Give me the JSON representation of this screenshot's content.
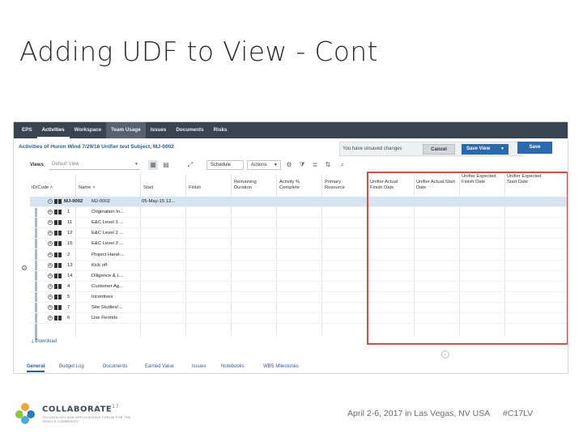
{
  "slide": {
    "title": "Adding UDF to View - Cont"
  },
  "nav": {
    "tabs": [
      "EPS",
      "Activities",
      "Workspace",
      "Team Usage",
      "Issues",
      "Documents",
      "Risks"
    ]
  },
  "header": {
    "page_title": "Activities of Huron Wind 7/29/16 Unifier test Subject, MJ-0002",
    "unsaved_text": "You have unsaved changes",
    "cancel_label": "Cancel",
    "save_view_label": "Save View",
    "save_label": "Save"
  },
  "toolbar": {
    "views_label": "Views",
    "views_value": "Default View",
    "schedule_label": "Schedule",
    "actions_label": "Actions"
  },
  "grid": {
    "columns": [
      "ID/Code ˄",
      "Name ˄",
      "Start",
      "Finish",
      "Remaining Duration",
      "Activity % Complete",
      "Primary Resource",
      "Unifier Actual Finish Date",
      "Unifier Actual Start Date",
      "Unifier Expected Finish Date",
      "Unifier Expected Start Date"
    ],
    "rows": [
      {
        "id": "MJ-0002",
        "name": "MJ-0002",
        "start": "05-May-15 12...",
        "selected": true
      },
      {
        "id": "1",
        "name": "Origination In...",
        "start": ""
      },
      {
        "id": "11",
        "name": "E&C Level 1 ...",
        "start": ""
      },
      {
        "id": "12",
        "name": "E&C Level 2 ...",
        "start": ""
      },
      {
        "id": "15",
        "name": "E&C Level 3 ...",
        "start": ""
      },
      {
        "id": "2",
        "name": "Project Hand-...",
        "start": ""
      },
      {
        "id": "13",
        "name": "Kick off",
        "start": ""
      },
      {
        "id": "14",
        "name": "Diligence & L...",
        "start": ""
      },
      {
        "id": "4",
        "name": "Customer Ag...",
        "start": ""
      },
      {
        "id": "5",
        "name": "Incentives",
        "start": ""
      },
      {
        "id": "7",
        "name": "Site Studies/...",
        "start": ""
      },
      {
        "id": "6",
        "name": "Use Permits",
        "start": ""
      }
    ]
  },
  "footer_actions": {
    "download_label": "Download"
  },
  "bottom_tabs": [
    "General",
    "Budget Log",
    "Documents",
    "Earned Value",
    "Issues",
    "Notebooks",
    "WBS Milestones"
  ],
  "footer": {
    "logo_text": "COLLABORATE",
    "logo_sup": "17",
    "logo_tagline": "TECHNOLOGY AND APPLICATIONS FORUM FOR THE ORACLE COMMUNITY",
    "date_text": "April 2-6, 2017 in Las Vegas, NV USA",
    "hashtag": "#C17LV"
  },
  "colors": {
    "nav_bg": "#3a4451",
    "accent_blue": "#2969b0",
    "highlight_red": "#e0493d",
    "row_selected": "#d6e4f2"
  }
}
